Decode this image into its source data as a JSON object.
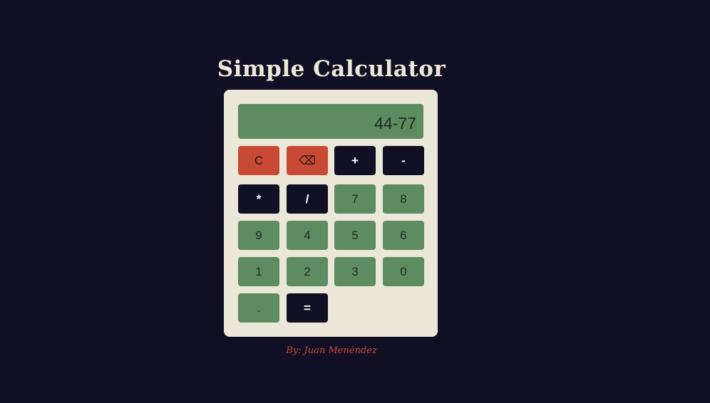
{
  "app": {
    "title": "Simple Calculator",
    "credit": "By: Juan Menéndez"
  },
  "display": {
    "value": "44-77"
  },
  "keys": {
    "clear": "C",
    "backspace": "⌫",
    "plus": "+",
    "minus": "-",
    "multiply": "*",
    "divide": "/",
    "seven": "7",
    "eight": "8",
    "nine": "9",
    "four": "4",
    "five": "5",
    "six": "6",
    "one": "1",
    "two": "2",
    "three": "3",
    "zero": "0",
    "decimal": ".",
    "equals": "="
  },
  "colors": {
    "background": "#110f24",
    "panel": "#ece8d9",
    "green": "#5e8c61",
    "red": "#c84a35",
    "dark": "#110f24",
    "title": "#ede8d8"
  }
}
